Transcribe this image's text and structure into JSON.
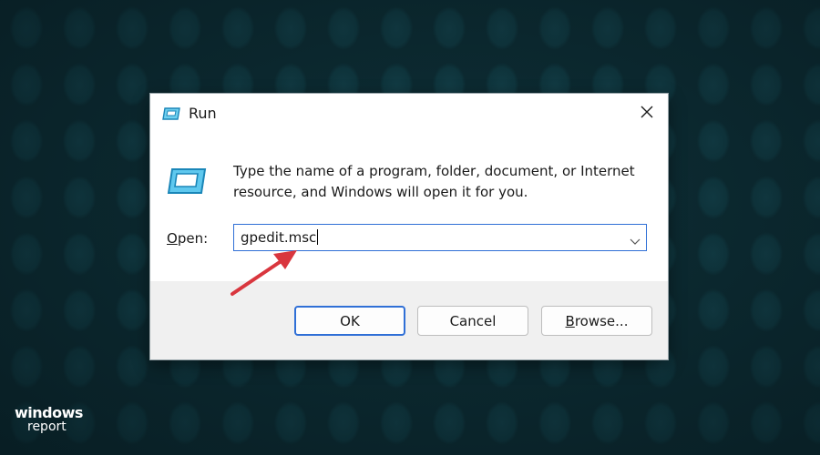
{
  "dialog": {
    "title": "Run",
    "description": "Type the name of a program, folder, document, or Internet resource, and Windows will open it for you.",
    "open_label_mnemonic": "O",
    "open_label_rest": "pen:",
    "input_value": "gpedit.msc",
    "buttons": {
      "ok": "OK",
      "cancel": "Cancel",
      "browse_mnemonic": "B",
      "browse_rest": "rowse..."
    },
    "icons": {
      "title": "run-icon",
      "main": "run-icon",
      "close": "close-icon",
      "dropdown": "chevron-down-icon"
    }
  },
  "annotation": {
    "arrow_color": "#d9363e"
  },
  "watermark": {
    "line1": "windows",
    "line2": "report"
  },
  "colors": {
    "accent": "#2f6fd6",
    "background": "#0c2a31"
  }
}
